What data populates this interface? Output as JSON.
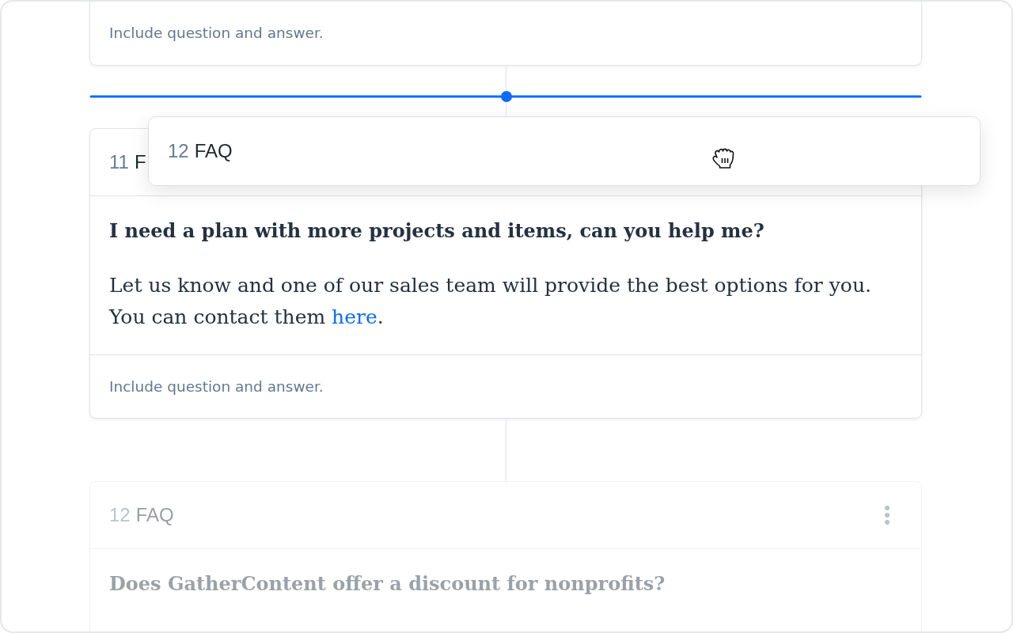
{
  "cards": [
    {
      "hint": "Include question and answer.",
      "dimmed": false
    },
    {
      "number": "11",
      "title": "F",
      "question": "I need a plan with more projects and items, can you help me?",
      "answer": [
        {
          "kind": "text",
          "text": "Let us know and one of our sales team will provide the best options for you. You can contact them "
        },
        {
          "kind": "link",
          "text": "here"
        },
        {
          "kind": "text",
          "text": "."
        }
      ],
      "hint": "Include question and answer.",
      "dimmed": false,
      "drop_before": true
    },
    {
      "number": "12",
      "title": "FAQ",
      "question": "Does GatherContent offer a discount for nonprofits?",
      "dimmed": true,
      "menu": true,
      "drop_before": false
    }
  ],
  "drag_preview": {
    "number": "12",
    "title": "FAQ"
  }
}
